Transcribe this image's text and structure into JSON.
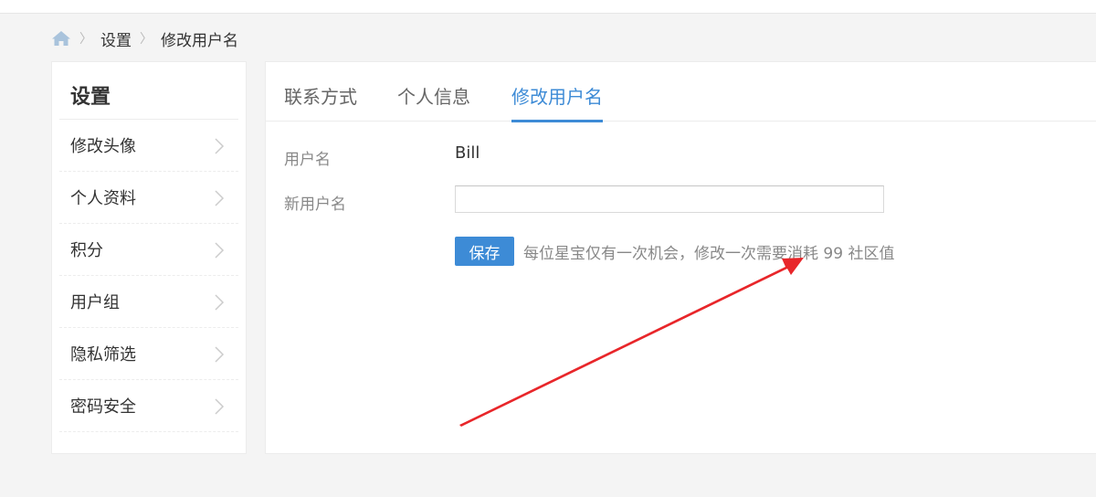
{
  "breadcrumb": {
    "home_icon": "home-icon",
    "items": [
      "设置",
      "修改用户名"
    ]
  },
  "sidebar": {
    "title": "设置",
    "items": [
      "修改头像",
      "个人资料",
      "积分",
      "用户组",
      "隐私筛选",
      "密码安全"
    ]
  },
  "tabs": {
    "items": [
      "联系方式",
      "个人信息",
      "修改用户名"
    ],
    "active": "修改用户名"
  },
  "form": {
    "username_label": "用户名",
    "username_value": "Bill",
    "new_username_label": "新用户名",
    "new_username_value": "",
    "save_label": "保存",
    "hint": "每位星宝仅有一次机会，修改一次需要消耗 99 社区值"
  },
  "colors": {
    "accent": "#3d8bd6",
    "annotation_arrow": "#e8262a",
    "background": "#f4f4f4"
  }
}
